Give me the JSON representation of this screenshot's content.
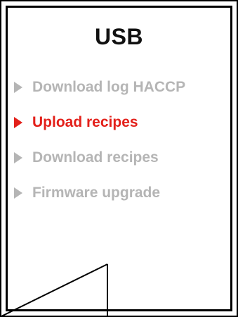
{
  "screen": {
    "title": "USB"
  },
  "menu": {
    "items": [
      {
        "label": "Download log HACCP",
        "selected": false
      },
      {
        "label": "Upload recipes",
        "selected": true
      },
      {
        "label": "Download recipes",
        "selected": false
      },
      {
        "label": "Firmware upgrade",
        "selected": false
      }
    ]
  },
  "colors": {
    "selected": "#e3201a",
    "unselected": "#b5b5b5",
    "frame": "#000000"
  }
}
